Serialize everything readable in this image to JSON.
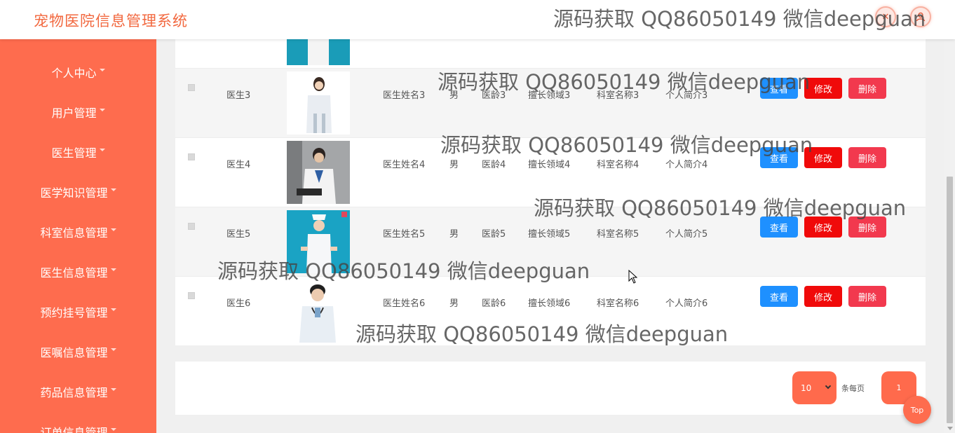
{
  "app": {
    "title": "宠物医院信息管理系统"
  },
  "topbar": {
    "icon1": "close-icon",
    "icon2": "user-icon"
  },
  "sidebar": {
    "items": [
      {
        "label": "个人中心"
      },
      {
        "label": "用户管理"
      },
      {
        "label": "医生管理"
      },
      {
        "label": "医学知识管理"
      },
      {
        "label": "科室信息管理"
      },
      {
        "label": "医生信息管理"
      },
      {
        "label": "预约挂号管理"
      },
      {
        "label": "医嘱信息管理"
      },
      {
        "label": "药品信息管理"
      },
      {
        "label": "订单信息管理"
      }
    ]
  },
  "table": {
    "rows": [
      {
        "account": "医生3",
        "name": "医生姓名3",
        "gender": "男",
        "age": "医龄3",
        "specialty": "擅长领域3",
        "dept": "科室名称3",
        "intro": "个人简介3"
      },
      {
        "account": "医生4",
        "name": "医生姓名4",
        "gender": "男",
        "age": "医龄4",
        "specialty": "擅长领域4",
        "dept": "科室名称4",
        "intro": "个人简介4"
      },
      {
        "account": "医生5",
        "name": "医生姓名5",
        "gender": "男",
        "age": "医龄5",
        "specialty": "擅长领域5",
        "dept": "科室名称5",
        "intro": "个人简介5"
      },
      {
        "account": "医生6",
        "name": "医生姓名6",
        "gender": "男",
        "age": "医龄6",
        "specialty": "擅长领域6",
        "dept": "科室名称6",
        "intro": "个人简介6"
      }
    ],
    "actions": {
      "view": "查看",
      "edit": "修改",
      "delete": "删除"
    }
  },
  "pagination": {
    "page_size": "10",
    "per_page_label": "条每页",
    "current_page": "1"
  },
  "back_to_top": "Top",
  "watermark": "源码获取 QQ86050149 微信deepguan",
  "colors": {
    "brand": "#fe6c4e",
    "view_button": "#1e90ff",
    "edit_button": "#f00a0a",
    "delete_button": "#f2394e"
  }
}
